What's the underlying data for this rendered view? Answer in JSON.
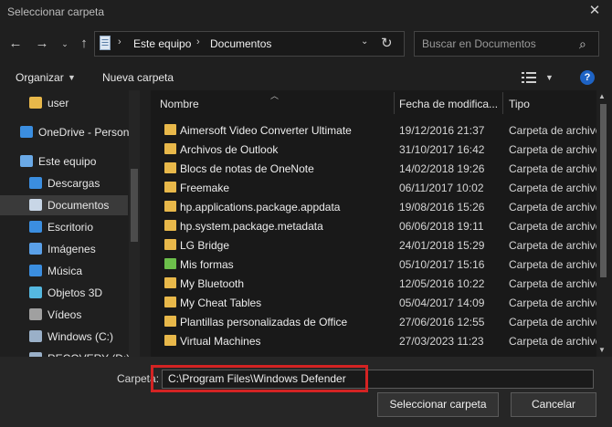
{
  "window": {
    "title": "Seleccionar carpeta"
  },
  "nav": {
    "address": [
      "Este equipo",
      "Documentos"
    ],
    "search_placeholder": "Buscar en Documentos"
  },
  "toolbar": {
    "organize": "Organizar",
    "new_folder": "Nueva carpeta"
  },
  "sidebar": {
    "items": [
      {
        "label": "user",
        "icon": "folder-icon",
        "color": "#e8b84a"
      },
      {
        "label": "OneDrive - Person",
        "icon": "cloud-icon",
        "color": "#3b8ee0"
      },
      {
        "label": "Este equipo",
        "icon": "computer-icon",
        "color": "#6aa9e6"
      },
      {
        "label": "Descargas",
        "icon": "download-icon",
        "color": "#3b8ee0"
      },
      {
        "label": "Documentos",
        "icon": "document-icon",
        "color": "#c8d6e6",
        "selected": true
      },
      {
        "label": "Escritorio",
        "icon": "desktop-icon",
        "color": "#3b8ee0"
      },
      {
        "label": "Imágenes",
        "icon": "pictures-icon",
        "color": "#5aa0e8"
      },
      {
        "label": "Música",
        "icon": "music-icon",
        "color": "#3b8ee0"
      },
      {
        "label": "Objetos 3D",
        "icon": "objects3d-icon",
        "color": "#55b8e0"
      },
      {
        "label": "Vídeos",
        "icon": "videos-icon",
        "color": "#a0a0a0"
      },
      {
        "label": "Windows (C:)",
        "icon": "drive-icon",
        "color": "#9ab0c8"
      },
      {
        "label": "RECOVERY (D:)",
        "icon": "drive-icon",
        "color": "#9ab0c8"
      }
    ]
  },
  "columns": {
    "name": "Nombre",
    "date": "Fecha de modifica...",
    "type": "Tipo"
  },
  "files": [
    {
      "name": "Aimersoft Video Converter Ultimate",
      "date": "19/12/2016 21:37",
      "type": "Carpeta de archivos"
    },
    {
      "name": "Archivos de Outlook",
      "date": "31/10/2017 16:42",
      "type": "Carpeta de archivos"
    },
    {
      "name": "Blocs de notas de OneNote",
      "date": "14/02/2018 19:26",
      "type": "Carpeta de archivos"
    },
    {
      "name": "Freemake",
      "date": "06/11/2017 10:02",
      "type": "Carpeta de archivos"
    },
    {
      "name": "hp.applications.package.appdata",
      "date": "19/08/2016 15:26",
      "type": "Carpeta de archivos"
    },
    {
      "name": "hp.system.package.metadata",
      "date": "06/06/2018 19:11",
      "type": "Carpeta de archivos"
    },
    {
      "name": "LG Bridge",
      "date": "24/01/2018 15:29",
      "type": "Carpeta de archivos"
    },
    {
      "name": "Mis formas",
      "date": "05/10/2017 15:16",
      "type": "Carpeta de archivos",
      "special": true
    },
    {
      "name": "My Bluetooth",
      "date": "12/05/2016 10:22",
      "type": "Carpeta de archivos"
    },
    {
      "name": "My Cheat Tables",
      "date": "05/04/2017 14:09",
      "type": "Carpeta de archivos"
    },
    {
      "name": "Plantillas personalizadas de Office",
      "date": "27/06/2016 12:55",
      "type": "Carpeta de archivos"
    },
    {
      "name": "Virtual Machines",
      "date": "27/03/2023 11:23",
      "type": "Carpeta de archivos"
    }
  ],
  "footer": {
    "folder_label": "Carpeta:",
    "folder_value": "C:\\Program Files\\Windows Defender",
    "select_button": "Seleccionar carpeta",
    "cancel_button": "Cancelar"
  }
}
